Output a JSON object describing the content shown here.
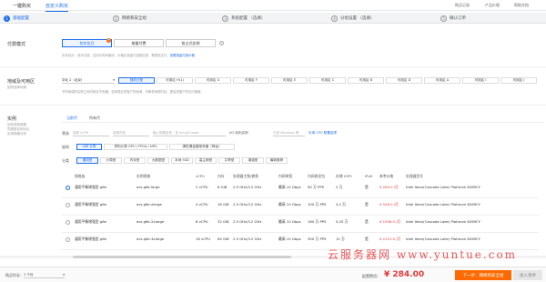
{
  "topbar": {
    "tabs": [
      "一键购买",
      "自定义购买"
    ],
    "right": [
      "购买记录",
      "产品价格",
      "帮助文档"
    ]
  },
  "steps": [
    {
      "num": "1",
      "label": "基础配置"
    },
    {
      "num": "2",
      "label": "网络和安全组"
    },
    {
      "num": "3",
      "label": "系统配置 （选填）"
    },
    {
      "num": "4",
      "label": "分组设置 （选填）"
    },
    {
      "num": "5",
      "label": "确认订单"
    }
  ],
  "billing": {
    "title": "付费模式",
    "options": [
      "包年包月",
      "按量付费",
      "抢占式实例"
    ],
    "hint": "包年包月：按月付费，支持长时间使用，价格比按量付费更优惠，需提前支付，",
    "hint_link": "查看按量付费价格"
  },
  "region": {
    "title": "地域及可用区",
    "sub": "如何选择地域",
    "select": "华北 2（北京）",
    "zones": [
      "随机分配",
      "可用区 H(1)",
      "可用区 G",
      "可用区 F",
      "可用区 E",
      "可用区 C",
      "可用区 B",
      "可用区 D",
      "可用区 A",
      "可用区 I",
      "可用区 J"
    ],
    "hint": "不同地域的实例之间内网互不相通；选择靠近您客户的地域，可降低网络时延，提高您客户的访问速度。"
  },
  "instance": {
    "title": "实例",
    "sub": [
      "如何选择规格",
      "同类型实例对比",
      "实例规格分析"
    ],
    "tabs": [
      "当前代",
      "所有代"
    ],
    "filter_label": "筛选",
    "filters": [
      "选择 vCPU",
      "选择内存",
      "输入规格名称，如 ecs.g5.large",
      "I/O 优化实例",
      "已选 Windows 等",
      "可选..."
    ],
    "filter_link": "可用 CPU 配置选项",
    "arch_label": "架构",
    "archs": [
      "x86 计算",
      "异构计算 GPU / FPGA / NPU",
      "弹性裸金属服务器（神龙）"
    ],
    "cat_label": "分类",
    "cats": [
      "通用型",
      "计算型",
      "内存型",
      "大数据型",
      "本地 SSD",
      "高主频型",
      "共享型",
      "增强型",
      "最新推荐"
    ]
  },
  "table": {
    "headers": [
      "规格族",
      "实例规格",
      "vCPU",
      "内存",
      "处理器主频/睿频",
      "内网带宽",
      "内网收发包",
      "存储 IOPS",
      "IPv6",
      "参考价格",
      "处理器型号"
    ],
    "rows": [
      {
        "family": "通用平衡增强型 g6e",
        "spec": "ecs.g6e.large",
        "vcpu": "2 vCPU",
        "mem": "8 GiB",
        "freq": "2.5 GHz/3.2 GHz",
        "bw": "最高 10 Gbps",
        "pps": "90 万 PPS",
        "iops": "2 万",
        "ipv6": "是",
        "price": "¥ 264.0 /月",
        "cpu": "Intel Xeon(Cascade Lake) Platinum 8269CY"
      },
      {
        "family": "通用平衡增强型 g6e",
        "spec": "ecs.g6e.xlarge",
        "vcpu": "4 vCPU",
        "mem": "16 GiB",
        "freq": "2.5 GHz/3.2 GHz",
        "bw": "最高 10 Gbps",
        "pps": "100 万 PPS",
        "iops": "4.2 万",
        "ipv6": "是",
        "price": "¥ 528.0 /月",
        "cpu": "Intel Xeon(Cascade Lake) Platinum 8269CY"
      },
      {
        "family": "通用平衡增强型 g6e",
        "spec": "ecs.g6e.2xlarge",
        "vcpu": "8 vCPU",
        "mem": "32 GiB",
        "freq": "2.5 GHz/3.2 GHz",
        "bw": "最高 10 Gbps",
        "pps": "160 万 PPS",
        "iops": "5.25 万",
        "ipv6": "是",
        "price": "¥ 1056.0 /月",
        "cpu": "Intel Xeon(Cascade Lake) Platinum 8269CY"
      },
      {
        "family": "通用平衡增强型 g6e",
        "spec": "ecs.g6e.4xlarge",
        "vcpu": "16 vCPU",
        "mem": "64 GiB",
        "freq": "2.5 GHz/3.2 GHz",
        "bw": "最高 10 Gbps",
        "pps": "300 万 PPS",
        "iops": "11 万",
        "ipv6": "是",
        "price": "¥ 2112.0 /月",
        "cpu": "Intel Xeon(Cascade Lake) Platinum 8269CY"
      }
    ]
  },
  "bottom": {
    "duration_label": "购买时长：",
    "duration_value": "1 个月",
    "fee_label": "配置费用：",
    "price": "¥ 284.00",
    "next": "下一步：网络和安全组",
    "add_cart": "加入清单"
  },
  "watermark": "云服务器网 www.yuntue.com",
  "colors": {
    "accent": "#1f6feb",
    "price": "#e4393c",
    "cta": "#ff6a00"
  }
}
